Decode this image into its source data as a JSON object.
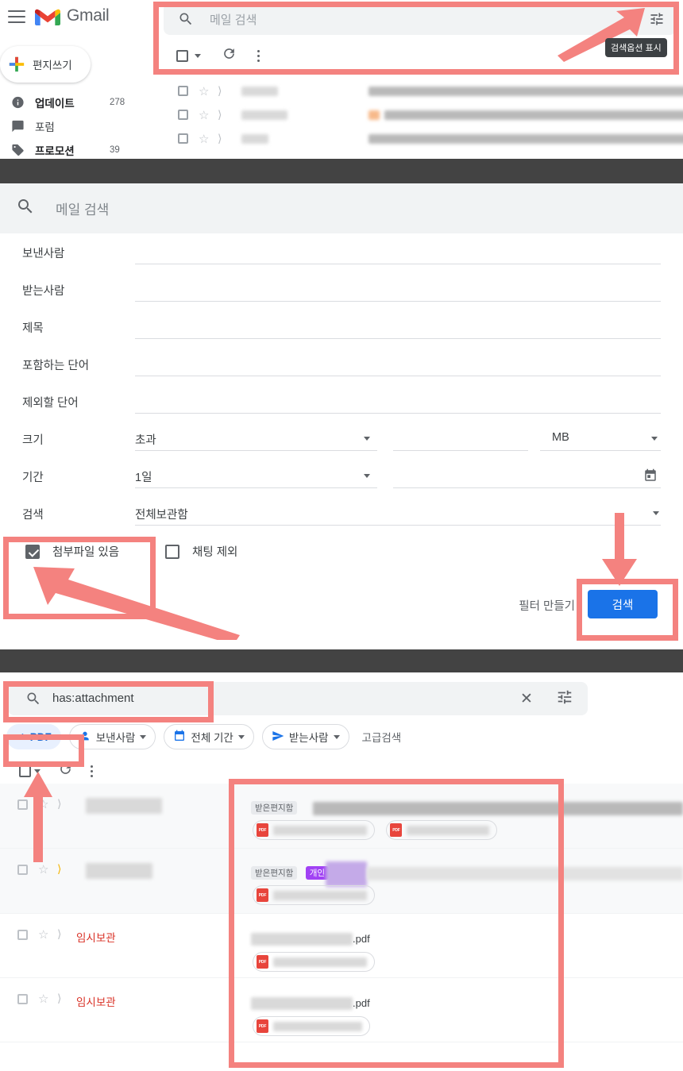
{
  "app": {
    "name": "Gmail"
  },
  "top_bar": {
    "menu_icon": "hamburger-icon",
    "search_placeholder": "메일 검색",
    "search_icon": "search-icon",
    "tune_icon": "tune-icon",
    "tooltip": "검색옵션 표시",
    "compose_label": "편지쓰기"
  },
  "sidebar": {
    "items": [
      {
        "label": "업데이트",
        "count": "278",
        "icon": "info-icon",
        "bold": true
      },
      {
        "label": "포럼",
        "count": "",
        "icon": "forum-icon",
        "bold": false
      },
      {
        "label": "프로모션",
        "count": "39",
        "icon": "tag-icon",
        "bold": true
      }
    ]
  },
  "advanced_panel": {
    "header_placeholder": "메일 검색",
    "search_icon": "search-icon",
    "fields": [
      {
        "label": "보낸사람",
        "value": ""
      },
      {
        "label": "받는사람",
        "value": ""
      },
      {
        "label": "제목",
        "value": ""
      },
      {
        "label": "포함하는 단어",
        "value": ""
      },
      {
        "label": "제외할 단어",
        "value": ""
      }
    ],
    "size_row": {
      "label": "크기",
      "operator": "초과",
      "amount": "",
      "unit": "MB"
    },
    "date_row": {
      "label": "기간",
      "within": "1일",
      "date": "",
      "calendar_icon": "calendar-icon"
    },
    "scope_row": {
      "label": "검색",
      "value": "전체보관함"
    },
    "checkboxes": [
      {
        "label": "첨부파일 있음",
        "checked": true
      },
      {
        "label": "채팅 제외",
        "checked": false
      }
    ],
    "create_filter_label": "필터 만들기",
    "search_button_label": "검색",
    "search_button_color": "#1a73e8"
  },
  "results": {
    "search_value": "has:attachment",
    "search_icon": "search-icon",
    "clear_icon": "close-icon",
    "tune_icon": "tune-icon",
    "chips": [
      {
        "label": "PDF",
        "icon": "check-icon",
        "active": true,
        "dropdown": false
      },
      {
        "label": "보낸사람",
        "icon": "person-icon",
        "active": false,
        "dropdown": true
      },
      {
        "label": "전체 기간",
        "icon": "calendar-icon",
        "active": false,
        "dropdown": true
      },
      {
        "label": "받는사람",
        "icon": "send-icon",
        "active": false,
        "dropdown": true
      }
    ],
    "advanced_link": "고급검색",
    "toolbar": {
      "select_all_icon": "checkbox-icon",
      "dropdown_icon": "caret-down-icon",
      "refresh_icon": "refresh-icon",
      "more_icon": "more-vertical-icon"
    },
    "rows": [
      {
        "sender": "",
        "draft_label": "",
        "star_icon": "star-icon",
        "important_icon": "important-icon",
        "important_amber": false,
        "labels": [
          {
            "text": "받은편지함",
            "style": "gray"
          }
        ],
        "attachments": [
          {
            "type": "PDF",
            "name": ""
          },
          {
            "type": "PDF",
            "name": ""
          }
        ]
      },
      {
        "sender": "",
        "draft_label": "",
        "star_icon": "star-icon",
        "important_icon": "important-icon",
        "important_amber": true,
        "labels": [
          {
            "text": "받은편지함",
            "style": "gray"
          },
          {
            "text": "개인",
            "style": "purple"
          }
        ],
        "attachments": [
          {
            "type": "PDF",
            "name": ""
          }
        ]
      },
      {
        "sender": "",
        "draft_label": "임시보관",
        "star_icon": "star-icon",
        "important_icon": "important-icon",
        "important_amber": false,
        "labels": [],
        "subject_suffix": ".pdf",
        "attachments": [
          {
            "type": "PDF",
            "name": ""
          }
        ]
      },
      {
        "sender": "",
        "draft_label": "임시보관",
        "star_icon": "star-icon",
        "important_icon": "important-icon",
        "important_amber": false,
        "labels": [],
        "subject_suffix": ".pdf",
        "attachments": [
          {
            "type": "PDF",
            "name": ""
          }
        ]
      }
    ]
  },
  "annotations": {
    "highlight_color": "#f4827f",
    "boxes": [
      "top-search-area",
      "attachment-checkbox",
      "search-button",
      "results-search-input",
      "pdf-chip",
      "attachment-column"
    ],
    "arrows": [
      "arrow-to-tune-icon",
      "arrow-to-search-button",
      "arrow-to-attachment-checkbox",
      "arrow-to-pdf-chip"
    ]
  }
}
